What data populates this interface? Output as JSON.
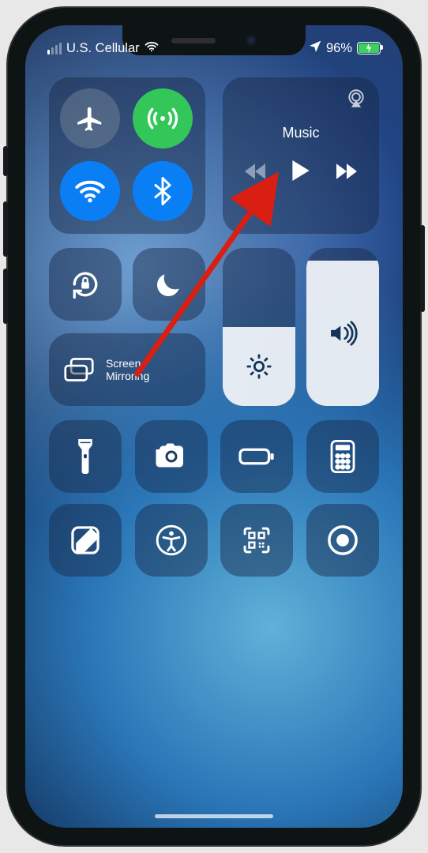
{
  "status": {
    "carrier": "U.S. Cellular",
    "signal_bars_active": 1,
    "signal_bars_total": 4,
    "battery_percent": "96%",
    "battery_level": 0.96
  },
  "connectivity": {
    "airplane": {
      "on": false
    },
    "cellular": {
      "on": true
    },
    "wifi": {
      "on": true
    },
    "bluetooth": {
      "on": true
    }
  },
  "music": {
    "title": "Music"
  },
  "toggles": {
    "rotation_lock": {
      "on": false
    },
    "do_not_disturb": {
      "on": false
    }
  },
  "mirror": {
    "label_line1": "Screen",
    "label_line2": "Mirroring"
  },
  "sliders": {
    "brightness": 0.5,
    "volume": 0.92
  },
  "annotation": {
    "target": "music-module"
  }
}
